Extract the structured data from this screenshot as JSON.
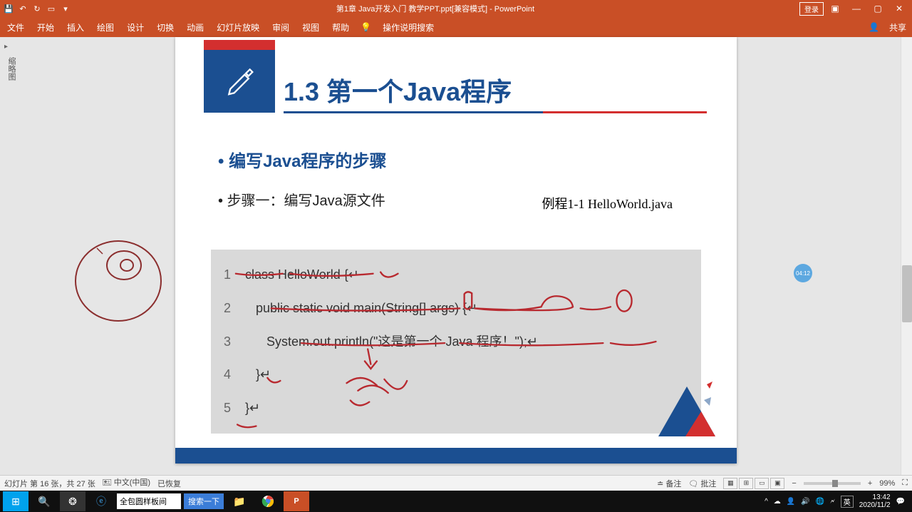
{
  "titlebar": {
    "title": "第1章 Java开发入门 教学PPT.ppt[兼容模式] - PowerPoint",
    "login": "登录"
  },
  "ribbon": {
    "file": "文件",
    "home": "开始",
    "insert": "插入",
    "draw": "绘图",
    "design": "设计",
    "transitions": "切换",
    "animations": "动画",
    "slideshow": "幻灯片放映",
    "review": "审阅",
    "view": "视图",
    "help": "帮助",
    "tellme": "操作说明搜索",
    "share": "共享"
  },
  "slide": {
    "title": "1.3 第一个Java程序",
    "bullet1": "编写Java程序的步骤",
    "bullet2": "步骤一：编写Java源文件",
    "example": "例程1-1  HelloWorld.java",
    "code": {
      "l1": "class HelloWorld {↵",
      "l2": "   public static void main(String[] args) {↵",
      "l3": "      System.out.println(\"这是第一个 Java 程序！\");↵",
      "l4": "   }↵",
      "l5": "}↵"
    }
  },
  "timer": "04:12",
  "status": {
    "slide_info": "幻灯片 第 16 张，共 27 张",
    "lang": "中文(中国)",
    "recovered": "已恢复",
    "notes": "备注",
    "comments": "批注",
    "zoom": "99%"
  },
  "taskbar": {
    "address": "全包圆样板间",
    "search": "搜索一下",
    "ime": "英",
    "time": "13:42",
    "date": "2020/11/2"
  }
}
